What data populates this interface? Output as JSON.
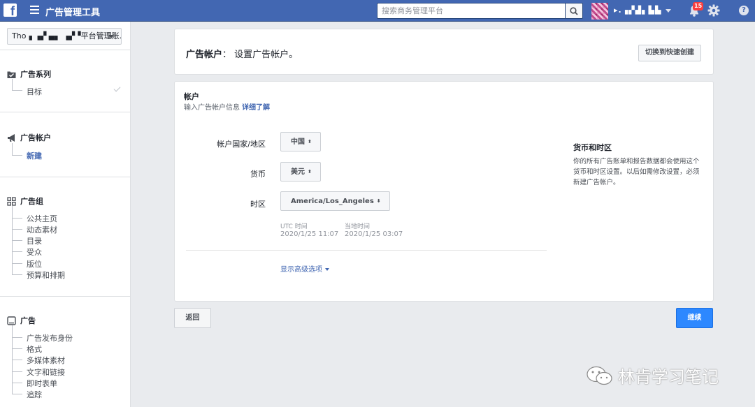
{
  "topbar": {
    "logo": "f",
    "title": "广告管理工具",
    "search_placeholder": "搜索商务管理平台",
    "user_name": "▸.▗▞▟▖▙▙",
    "notification_count": "15",
    "help": "?"
  },
  "sidebar": {
    "account_select": "Tho▗ ▗▞ ▄▖ ▗▞▝平台管理账...",
    "campaign": {
      "title": "广告系列",
      "items": [
        "目标"
      ]
    },
    "adaccount": {
      "title": "广告帐户",
      "items": [
        "新建"
      ]
    },
    "adset": {
      "title": "广告组",
      "items": [
        "公共主页",
        "动态素材",
        "目录",
        "受众",
        "版位",
        "预算和排期"
      ]
    },
    "ad": {
      "title": "广告",
      "items": [
        "广告发布身份",
        "格式",
        "多媒体素材",
        "文字和链接",
        "即时表单",
        "追踪"
      ]
    }
  },
  "header_panel": {
    "title_bold": "广告帐户",
    "title_rest": "： 设置广告帐户。",
    "switch_button": "切换到快速创建"
  },
  "account_panel": {
    "title": "帐户",
    "subtitle": "输入广告帐户信息",
    "learn_more": "详细了解",
    "country_label": "帐户国家/地区",
    "country_value": "中国",
    "currency_label": "货币",
    "currency_value": "美元",
    "timezone_label": "时区",
    "timezone_value": "America/Los_Angeles",
    "utc_caption": "UTC 时间",
    "utc_value": "2020/1/25 11:07",
    "local_caption": "当地时间",
    "local_value": "2020/1/25 03:07",
    "advanced_link": "显示高级选项",
    "info_title": "货币和时区",
    "info_body": "你的所有广告账单和报告数据都会使用这个货币和时区设置。以后如需修改设置，必须新建广告帐户。"
  },
  "footer": {
    "back_button": "返回",
    "continue_button": "继续"
  },
  "watermark": "林肯学习笔记",
  "colors": {
    "brand": "#4267b2",
    "primary_button": "#2d88ff",
    "badge": "#fa3e3e"
  }
}
